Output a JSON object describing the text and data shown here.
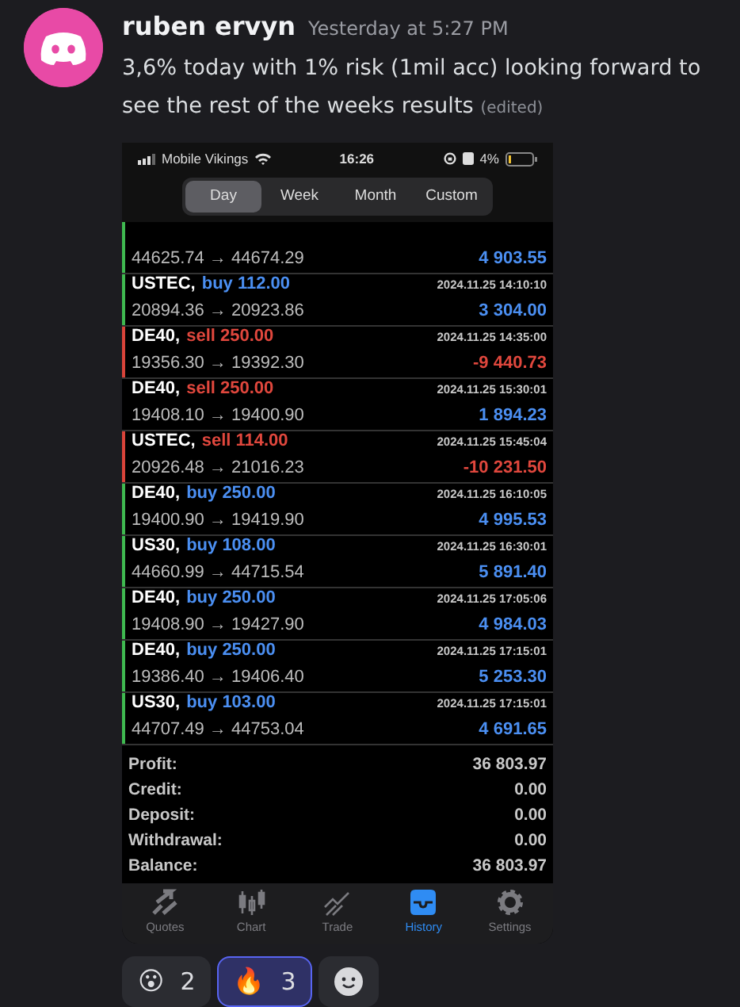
{
  "message": {
    "author": "ruben ervyn",
    "timestamp": "Yesterday at 5:27 PM",
    "text": "3,6% today with 1% risk (1mil acc) looking forward to see the rest of the weeks results",
    "edited": "(edited)"
  },
  "phone": {
    "status_bar": {
      "carrier": "Mobile Vikings",
      "time": "16:26",
      "battery": "4%"
    },
    "period_tabs": [
      {
        "label": "Day",
        "selected": true
      },
      {
        "label": "Week",
        "selected": false
      },
      {
        "label": "Month",
        "selected": false
      },
      {
        "label": "Custom",
        "selected": false
      }
    ],
    "deals": [
      {
        "prices": "44625.74 → 44674.29",
        "profit": "4 903.55",
        "loss": false,
        "color": "#3fb950"
      },
      {
        "symbol": "USTEC,",
        "order": "buy 112.00",
        "kind": "buy",
        "time": "2024.11.25 14:10:10",
        "prices": "20894.36 → 20923.86",
        "profit": "3 304.00",
        "loss": false,
        "color": "#3fb950"
      },
      {
        "symbol": "DE40,",
        "order": "sell 250.00",
        "kind": "sell",
        "time": "2024.11.25 14:35:00",
        "prices": "19356.30 → 19392.30",
        "profit": "-9 440.73",
        "loss": true,
        "color": "#d9443a"
      },
      {
        "symbol": "DE40,",
        "order": "sell 250.00",
        "kind": "sell",
        "time": "2024.11.25 15:30:01",
        "prices": "19408.10 → 19400.90",
        "profit": "1 894.23",
        "loss": false
      },
      {
        "symbol": "USTEC,",
        "order": "sell 114.00",
        "kind": "sell",
        "time": "2024.11.25 15:45:04",
        "prices": "20926.48 → 21016.23",
        "profit": "-10 231.50",
        "loss": true,
        "color": "#d9443a"
      },
      {
        "symbol": "DE40,",
        "order": "buy 250.00",
        "kind": "buy",
        "time": "2024.11.25 16:10:05",
        "prices": "19400.90 → 19419.90",
        "profit": "4 995.53",
        "loss": false,
        "color": "#3fb950"
      },
      {
        "symbol": "US30,",
        "order": "buy 108.00",
        "kind": "buy",
        "time": "2024.11.25 16:30:01",
        "prices": "44660.99 → 44715.54",
        "profit": "5 891.40",
        "loss": false,
        "color": "#3fb950"
      },
      {
        "symbol": "DE40,",
        "order": "buy 250.00",
        "kind": "buy",
        "time": "2024.11.25 17:05:06",
        "prices": "19408.90 → 19427.90",
        "profit": "4 984.03",
        "loss": false,
        "color": "#3fb950"
      },
      {
        "symbol": "DE40,",
        "order": "buy 250.00",
        "kind": "buy",
        "time": "2024.11.25 17:15:01",
        "prices": "19386.40 → 19406.40",
        "profit": "5 253.30",
        "loss": false,
        "color": "#3fb950"
      },
      {
        "symbol": "US30,",
        "order": "buy 103.00",
        "kind": "buy",
        "time": "2024.11.25 17:15:01",
        "prices": "44707.49 → 44753.04",
        "profit": "4 691.65",
        "loss": false,
        "color": "#3fb950"
      }
    ],
    "summary": [
      {
        "label": "Profit:",
        "value": "36 803.97"
      },
      {
        "label": "Credit:",
        "value": "0.00"
      },
      {
        "label": "Deposit:",
        "value": "0.00"
      },
      {
        "label": "Withdrawal:",
        "value": "0.00"
      },
      {
        "label": "Balance:",
        "value": "36 803.97"
      }
    ],
    "tab_bar": [
      {
        "kind": "quotes",
        "label": "Quotes",
        "selected": false
      },
      {
        "kind": "chart",
        "label": "Chart",
        "selected": false
      },
      {
        "kind": "trade",
        "label": "Trade",
        "selected": false
      },
      {
        "kind": "history",
        "label": "History",
        "selected": true
      },
      {
        "kind": "settings",
        "label": "Settings",
        "selected": false
      }
    ]
  },
  "reactions": [
    {
      "kind": "emoji",
      "emoji": "😮",
      "count": "2",
      "selected": false
    },
    {
      "kind": "emoji",
      "emoji": "🔥",
      "count": "3",
      "selected": true
    },
    {
      "kind": "add"
    }
  ]
}
